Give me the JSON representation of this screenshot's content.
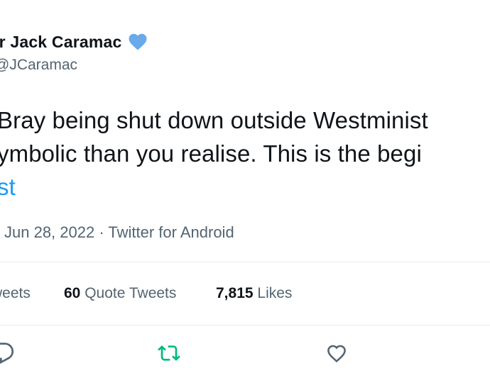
{
  "author": {
    "display_name": "ir Jack Caramac",
    "handle": "JCaramac",
    "verified_icon": "verified-heart-icon",
    "verified_color": "#6aa9ea"
  },
  "tweet": {
    "lines": [
      "Bray being shut down outside Westminist",
      "ymbolic than you realise. This is the begi",
      "st"
    ],
    "link_color": "#1d9bf0"
  },
  "meta": {
    "text": "Jun 28, 2022 · Twitter for Android"
  },
  "stats": {
    "retweets_label": "weets",
    "quote_count": "60",
    "quote_label": "Quote Tweets",
    "like_count": "7,815",
    "like_label": "Likes"
  },
  "actions": {
    "reply_icon": "reply-icon",
    "retweet_icon": "retweet-icon",
    "retweet_color": "#00ba7c",
    "like_icon": "heart-icon"
  }
}
